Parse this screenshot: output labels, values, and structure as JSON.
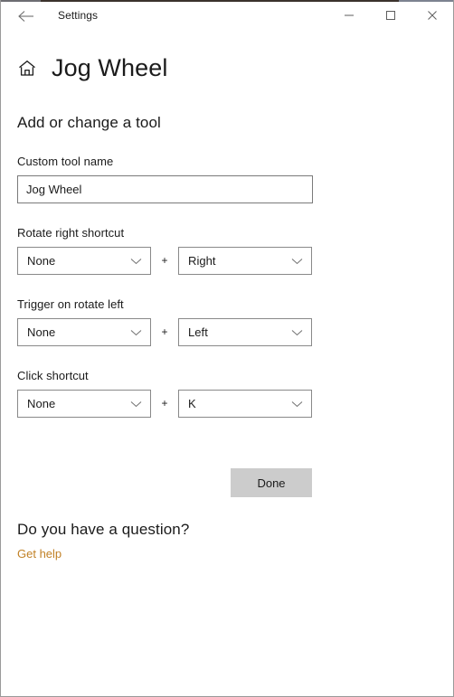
{
  "titlebar": {
    "back_icon": "back-arrow-icon",
    "title": "Settings",
    "minimize_icon": "minimize-icon",
    "maximize_icon": "maximize-icon",
    "close_icon": "close-icon"
  },
  "page": {
    "home_icon": "home-icon",
    "title": "Jog Wheel",
    "section_heading": "Add or change a tool"
  },
  "tool_name": {
    "label": "Custom tool name",
    "value": "Jog Wheel",
    "placeholder": "Custom tool name"
  },
  "shortcuts": [
    {
      "label": "Rotate right shortcut",
      "modifier": "None",
      "separator": "+",
      "key": "Right"
    },
    {
      "label": "Trigger on rotate left",
      "modifier": "None",
      "separator": "+",
      "key": "Left"
    },
    {
      "label": "Click shortcut",
      "modifier": "None",
      "separator": "+",
      "key": "K"
    }
  ],
  "actions": {
    "done_label": "Done"
  },
  "footer": {
    "heading": "Do you have a question?",
    "link_label": "Get help",
    "link_color": "#c18126"
  },
  "chevron_icon": "chevron-down-icon"
}
